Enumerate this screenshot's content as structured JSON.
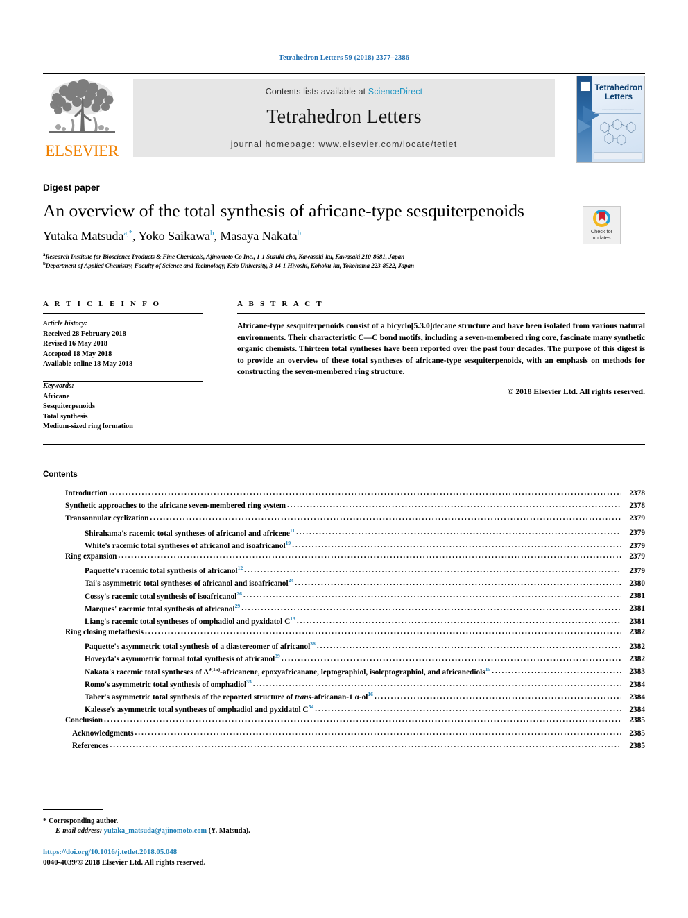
{
  "running_head": "Tetrahedron Letters 59 (2018) 2377–2386",
  "masthead": {
    "contents_prefix": "Contents lists available at ",
    "sciencedirect": "ScienceDirect",
    "journal_title": "Tetrahedron Letters",
    "homepage": "journal homepage: www.elsevier.com/locate/tetlet",
    "publisher_logo_text": "ELSEVIER",
    "cover_title_line1": "Tetrahedron",
    "cover_title_line2": "Letters",
    "link_color": "#2196c4",
    "brand_orange": "#F08000"
  },
  "title_block": {
    "category": "Digest paper",
    "title": "An overview of the total synthesis of africane-type sesquiterpenoids",
    "authors": [
      {
        "name": "Yutaka Matsuda",
        "marks": "a,*"
      },
      {
        "name": "Yoko Saikawa",
        "marks": "b"
      },
      {
        "name": "Masaya Nakata",
        "marks": "b"
      }
    ],
    "affiliations": [
      {
        "mark": "a",
        "text": "Research Institute for Bioscience Products & Fine Chemicals, Ajinomoto Co Inc., 1-1 Suzuki-cho, Kawasaki-ku, Kawasaki 210-8681, Japan"
      },
      {
        "mark": "b",
        "text": "Department of Applied Chemistry, Faculty of Science and Technology, Keio University, 3-14-1 Hiyoshi, Kohoku-ku, Yokohama 223-8522, Japan"
      }
    ],
    "crossmark_label_line1": "Check for",
    "crossmark_label_line2": "updates"
  },
  "article_info": {
    "heading": "A R T I C L E   I N F O",
    "history_label": "Article history:",
    "history": [
      "Received 28 February 2018",
      "Revised 16 May 2018",
      "Accepted 18 May 2018",
      "Available online 18 May 2018"
    ],
    "keywords_label": "Keywords:",
    "keywords": [
      "Africane",
      "Sesquiterpenoids",
      "Total synthesis",
      "Medium-sized ring formation"
    ]
  },
  "abstract": {
    "heading": "A B S T R A C T",
    "text": "Africane-type sesquiterpenoids consist of a bicyclo[5.3.0]decane structure and have been isolated from various natural environments. Their characteristic C—C bond motifs, including a seven-membered ring core, fascinate many synthetic organic chemists. Thirteen total syntheses have been reported over the past four decades. The purpose of this digest is to provide an overview of these total syntheses of africane-type sesquiterpenoids, with an emphasis on methods for constructing the seven-membered ring structure.",
    "copyright": "© 2018 Elsevier Ltd. All rights reserved."
  },
  "contents": {
    "heading": "Contents",
    "entries": [
      {
        "level": 1,
        "label": "Introduction",
        "sup": "",
        "page": "2378"
      },
      {
        "level": 1,
        "label": "Synthetic approaches to the africane seven-membered ring system",
        "sup": "",
        "page": "2378"
      },
      {
        "level": 1,
        "label": "Transannular cyclization",
        "sup": "",
        "page": "2379"
      },
      {
        "level": 2,
        "label": "Shirahama's racemic total syntheses of africanol and africene",
        "sup": "11",
        "page": "2379"
      },
      {
        "level": 2,
        "label": "White's racemic total syntheses of africanol and isoafricanol",
        "sup": "19",
        "page": "2379"
      },
      {
        "level": 1,
        "label": "Ring expansion",
        "sup": "",
        "page": "2379"
      },
      {
        "level": 2,
        "label": "Paquette's racemic total synthesis of africanol",
        "sup": "12",
        "page": "2379"
      },
      {
        "level": 2,
        "label": "Tai's asymmetric total syntheses of africanol and isoafricanol",
        "sup": "24",
        "page": "2380"
      },
      {
        "level": 2,
        "label": "Cossy's racemic total synthesis of isoafricanol",
        "sup": "26",
        "page": "2381"
      },
      {
        "level": 2,
        "label": "Marques' racemic total synthesis of africanol",
        "sup": "29",
        "page": "2381"
      },
      {
        "level": 2,
        "label": "Liang's racemic total syntheses of omphadiol and pyxidatol C",
        "sup": "13",
        "page": "2381"
      },
      {
        "level": 1,
        "label": "Ring closing metathesis",
        "sup": "",
        "page": "2382"
      },
      {
        "level": 2,
        "label": "Paquette's asymmetric total synthesis of a diastereomer of africanol",
        "sup": "36",
        "page": "2382"
      },
      {
        "level": 2,
        "label": "Hoveyda's asymmetric formal total synthesis of africanol",
        "sup": "39",
        "page": "2382"
      },
      {
        "level": 2,
        "label": "Nakata's racemic total syntheses of Δ9(15)-africanene, epoxyafricanane, leptographiol, isoleptographiol, and africanediols",
        "sup": "15",
        "page": "2383"
      },
      {
        "level": 2,
        "label": "Romo's asymmetric total synthesis of omphadiol",
        "sup": "35",
        "page": "2384"
      },
      {
        "level": 2,
        "label": "Taber's asymmetric total synthesis of the reported structure of trans-africanan-1 α-ol",
        "sup": "16",
        "page": "2384"
      },
      {
        "level": 2,
        "label": "Kalesse's asymmetric total syntheses of omphadiol and pyxidatol C",
        "sup": "54",
        "page": "2384"
      },
      {
        "level": 1,
        "label": "Conclusion",
        "sup": "",
        "page": "2385"
      },
      {
        "level": 3,
        "label": "Acknowledgments",
        "sup": "",
        "page": "2385"
      },
      {
        "level": 3,
        "label": "References",
        "sup": "",
        "page": "2385"
      }
    ]
  },
  "footer": {
    "corresponding_star": "*",
    "corresponding_text": "Corresponding author.",
    "email_label": "E-mail address:",
    "email": "yutaka_matsuda@ajinomoto.com",
    "email_suffix": "(Y. Matsuda).",
    "doi": "https://doi.org/10.1016/j.tetlet.2018.05.048",
    "issn_line": "0040-4039/© 2018 Elsevier Ltd. All rights reserved."
  }
}
